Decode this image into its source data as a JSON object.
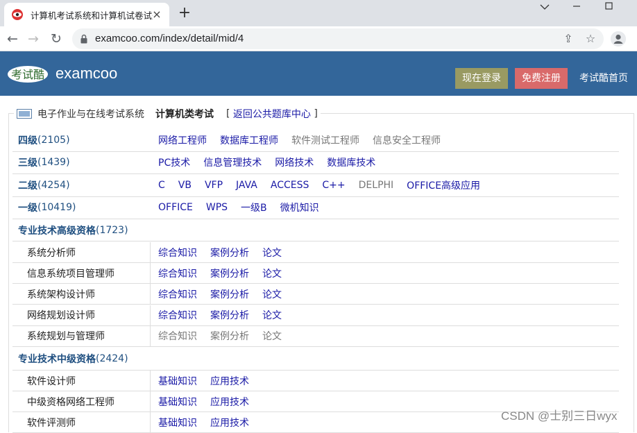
{
  "browser": {
    "tab_title": "计算机考试系统和计算机试卷试题",
    "url": "examcoo.com/index/detail/mid/4"
  },
  "header": {
    "brand": "examcoo",
    "logo_text": "考试酷",
    "login": "现在登录",
    "register": "免费注册",
    "home": "考试酷首页"
  },
  "breadcrumb": {
    "system": "电子作业与在线考试系统",
    "category": "计算机类考试",
    "open": "[",
    "back": "返回公共题库中心",
    "close": "]"
  },
  "levels": [
    {
      "name": "四级",
      "count": "(2105)",
      "links": [
        {
          "text": "网络工程师",
          "gray": false
        },
        {
          "text": "数据库工程师",
          "gray": false
        },
        {
          "text": "软件测试工程师",
          "gray": true
        },
        {
          "text": "信息安全工程师",
          "gray": true
        }
      ]
    },
    {
      "name": "三级",
      "count": "(1439)",
      "links": [
        {
          "text": "PC技术",
          "gray": false
        },
        {
          "text": "信息管理技术",
          "gray": false
        },
        {
          "text": "网络技术",
          "gray": false
        },
        {
          "text": "数据库技术",
          "gray": false
        }
      ]
    },
    {
      "name": "二级",
      "count": "(4254)",
      "links": [
        {
          "text": "C",
          "gray": false
        },
        {
          "text": "VB",
          "gray": false
        },
        {
          "text": "VFP",
          "gray": false
        },
        {
          "text": "JAVA",
          "gray": false
        },
        {
          "text": "ACCESS",
          "gray": false
        },
        {
          "text": "C++",
          "gray": false
        },
        {
          "text": "DELPHI",
          "gray": true
        },
        {
          "text": "OFFICE高级应用",
          "gray": false
        }
      ]
    },
    {
      "name": "一级",
      "count": "(10419)",
      "links": [
        {
          "text": "OFFICE",
          "gray": false
        },
        {
          "text": "WPS",
          "gray": false
        },
        {
          "text": "一级B",
          "gray": false
        },
        {
          "text": "微机知识",
          "gray": false
        }
      ]
    }
  ],
  "advanced": {
    "name": "专业技术高级资格",
    "count": "(1723)",
    "items": [
      {
        "name": "系统分析师",
        "links": [
          {
            "text": "综合知识",
            "gray": false
          },
          {
            "text": "案例分析",
            "gray": false
          },
          {
            "text": "论文",
            "gray": false
          }
        ]
      },
      {
        "name": "信息系统项目管理师",
        "links": [
          {
            "text": "综合知识",
            "gray": false
          },
          {
            "text": "案例分析",
            "gray": false
          },
          {
            "text": "论文",
            "gray": false
          }
        ]
      },
      {
        "name": "系统架构设计师",
        "links": [
          {
            "text": "综合知识",
            "gray": false
          },
          {
            "text": "案例分析",
            "gray": false
          },
          {
            "text": "论文",
            "gray": false
          }
        ]
      },
      {
        "name": "网络规划设计师",
        "links": [
          {
            "text": "综合知识",
            "gray": false
          },
          {
            "text": "案例分析",
            "gray": false
          },
          {
            "text": "论文",
            "gray": false
          }
        ]
      },
      {
        "name": "系统规划与管理师",
        "links": [
          {
            "text": "综合知识",
            "gray": true
          },
          {
            "text": "案例分析",
            "gray": true
          },
          {
            "text": "论文",
            "gray": true
          }
        ]
      }
    ]
  },
  "intermediate": {
    "name": "专业技术中级资格",
    "count": "(2424)",
    "items": [
      {
        "name": "软件设计师",
        "links": [
          {
            "text": "基础知识",
            "gray": false
          },
          {
            "text": "应用技术",
            "gray": false
          }
        ]
      },
      {
        "name": "中级资格网络工程师",
        "links": [
          {
            "text": "基础知识",
            "gray": false
          },
          {
            "text": "应用技术",
            "gray": false
          }
        ]
      },
      {
        "name": "软件评测师",
        "links": [
          {
            "text": "基础知识",
            "gray": false
          },
          {
            "text": "应用技术",
            "gray": false
          }
        ]
      }
    ]
  },
  "watermark": "CSDN @士别三日wyx"
}
